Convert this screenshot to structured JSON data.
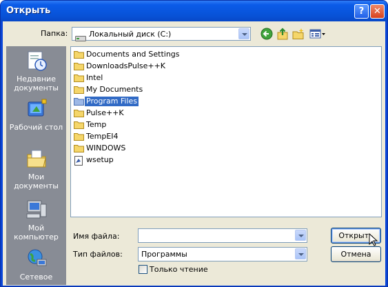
{
  "window": {
    "title": "Открыть",
    "help_glyph": "?",
    "close_glyph": "✕"
  },
  "lookin": {
    "label": "Папка:",
    "value": "Локальный диск (C:)"
  },
  "toolbar": {
    "back_icon": "back-arrow-icon",
    "up_icon": "up-folder-icon",
    "new_icon": "new-folder-icon",
    "views_icon": "views-menu-icon"
  },
  "places": [
    {
      "label": "Недавние документы",
      "icon": "recent-documents-icon"
    },
    {
      "label": "Рабочий стол",
      "icon": "desktop-icon"
    },
    {
      "label": "Мои документы",
      "icon": "my-documents-icon"
    },
    {
      "label": "Мой компьютер",
      "icon": "my-computer-icon"
    },
    {
      "label": "Сетевое",
      "icon": "network-icon"
    }
  ],
  "files": [
    {
      "name": "Documents and Settings",
      "type": "folder"
    },
    {
      "name": "DownloadsPulse++K",
      "type": "folder"
    },
    {
      "name": "Intel",
      "type": "folder"
    },
    {
      "name": "My Documents",
      "type": "folder"
    },
    {
      "name": "Program Files",
      "type": "folder",
      "selected": true
    },
    {
      "name": "Pulse++K",
      "type": "folder"
    },
    {
      "name": "Temp",
      "type": "folder"
    },
    {
      "name": "TempEI4",
      "type": "folder"
    },
    {
      "name": "WINDOWS",
      "type": "folder"
    },
    {
      "name": "wsetup",
      "type": "file"
    }
  ],
  "filename": {
    "label": "Имя файла:",
    "value": ""
  },
  "filetype": {
    "label": "Тип файлов:",
    "value": "Программы"
  },
  "readonly": {
    "label": "Только чтение",
    "checked": false
  },
  "buttons": {
    "open": "Открыть",
    "cancel": "Отмена"
  },
  "colors": {
    "title_bar": "#0b5be8",
    "selection": "#316ac5",
    "places_bar": "#888c95",
    "dialog_bg": "#ece9d8"
  }
}
